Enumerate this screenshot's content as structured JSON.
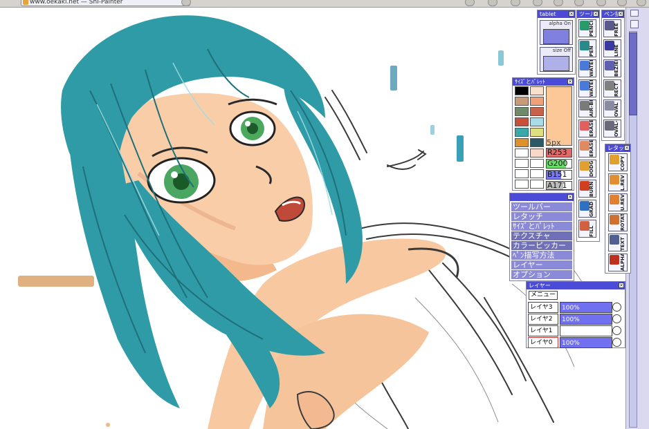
{
  "browser": {
    "tab_title": "www.oekaki.net — Shi-Painter"
  },
  "tablet_panel": {
    "title": "tablet",
    "alpha_label": "alpha On",
    "size_label": "size Off"
  },
  "tool_panel": {
    "title": "ツール",
    "tools": [
      {
        "label": "PENCIL",
        "icon": "pencil-icon",
        "color": "#2a9a6a"
      },
      {
        "label": "PEN",
        "icon": "pen-icon",
        "color": "#2a8a8a"
      },
      {
        "label": "WATER",
        "icon": "water-brush-icon",
        "color": "#4a7ad8"
      },
      {
        "label": "WATER2",
        "icon": "water-brush2-icon",
        "color": "#4a7ad8"
      },
      {
        "label": "AIR-BR",
        "icon": "airbrush-icon",
        "color": "#7a7a7a"
      },
      {
        "label": "ERASER",
        "icon": "eraser-icon",
        "color": "#e06060"
      },
      {
        "label": "ERASER2",
        "icon": "eraser2-icon",
        "color": "#e08a60"
      },
      {
        "label": "DODGE",
        "icon": "dodge-icon",
        "color": "#e0a030"
      },
      {
        "label": "BURN",
        "icon": "burn-icon",
        "color": "#d04020"
      },
      {
        "label": "GRAD",
        "icon": "gradient-icon",
        "color": "#3070c0"
      },
      {
        "label": "FILL",
        "icon": "fill-bucket-icon",
        "color": "#d06040"
      }
    ]
  },
  "pen_mode_panel": {
    "title": "ペン描",
    "modes": [
      {
        "label": "FREE",
        "icon": "freehand-icon",
        "color": "#5a5a8a"
      },
      {
        "label": "LINE",
        "icon": "line-icon",
        "color": "#3a3aa0"
      },
      {
        "label": "BEZIER",
        "icon": "bezier-icon",
        "color": "#6060b0"
      },
      {
        "label": "RECT",
        "icon": "rect-icon",
        "color": "#808080"
      },
      {
        "label": "OVAL",
        "icon": "oval-icon",
        "color": "#8a8aa0"
      },
      {
        "label": "OVAL-F",
        "icon": "oval-fill-icon",
        "color": "#6a6a7a"
      }
    ]
  },
  "retouch_panel": {
    "title": "レタッ",
    "tools": [
      {
        "label": "COPY",
        "icon": "copy-icon",
        "color": "#e0a030"
      },
      {
        "label": "L.REV",
        "icon": "lr-reverse-icon",
        "color": "#e09030"
      },
      {
        "label": "U.REV",
        "icon": "ud-reverse-icon",
        "color": "#e08030"
      },
      {
        "label": "ROTATE",
        "icon": "rotate-icon",
        "color": "#d07030"
      },
      {
        "label": "TEXT",
        "icon": "text-icon",
        "color": "#506090"
      },
      {
        "label": "ALPHA",
        "icon": "alpha-icon",
        "color": "#c03020"
      }
    ]
  },
  "palette_panel": {
    "title": "ｻｲｽﾞとﾊﾟﾚｯﾄ",
    "size_label": "5px",
    "r_label": "R253",
    "g_label": "G200",
    "b_label": "B151",
    "a_label": "A171",
    "swatches": [
      "#000000",
      "#f8e0cc",
      "#c89a78",
      "#f2a07a",
      "#6e8a6a",
      "#c8624a",
      "#c8503a",
      "#a8dce8",
      "#3aa8a8",
      "#e0e080",
      "#e0902a",
      "#2a5a68",
      "#ffffff",
      "#f8d8c8",
      "#ffffff",
      "#ffffff",
      "#ffffff",
      "#ffffff",
      "#ffffff",
      "#ffffff"
    ],
    "current_color": "#fdc897"
  },
  "window_menu": {
    "items": [
      "ツールバー",
      "レタッチ",
      "ｻｲｽﾞとﾊﾟﾚｯﾄ",
      "テクスチャ",
      "カラーピッカー",
      "ﾍﾟﾝ描写方法",
      "レイヤー",
      "オプション"
    ]
  },
  "layer_panel": {
    "title": "レイヤー",
    "menu_label": "メニュー",
    "layers": [
      {
        "name": "レイヤ3",
        "opacity": "100%",
        "bar": 1.0
      },
      {
        "name": "レイヤ2",
        "opacity": "100%",
        "bar": 1.0
      },
      {
        "name": "レイヤ1",
        "opacity": "",
        "bar": 0.0
      },
      {
        "name": "レイヤ0",
        "opacity": "100%",
        "bar": 1.0
      }
    ]
  },
  "colors": {
    "panel_title_bg": "#4b4bd8",
    "menu_item_bg": "#8a8ad8",
    "menu_item_active": "#7070b8",
    "layer_bar": "#7070f0",
    "r_bg": "#e06a6a",
    "g_bg": "#6ae06a",
    "b_bg": "#7a7af0",
    "a_bg": "#bdbdbd"
  }
}
